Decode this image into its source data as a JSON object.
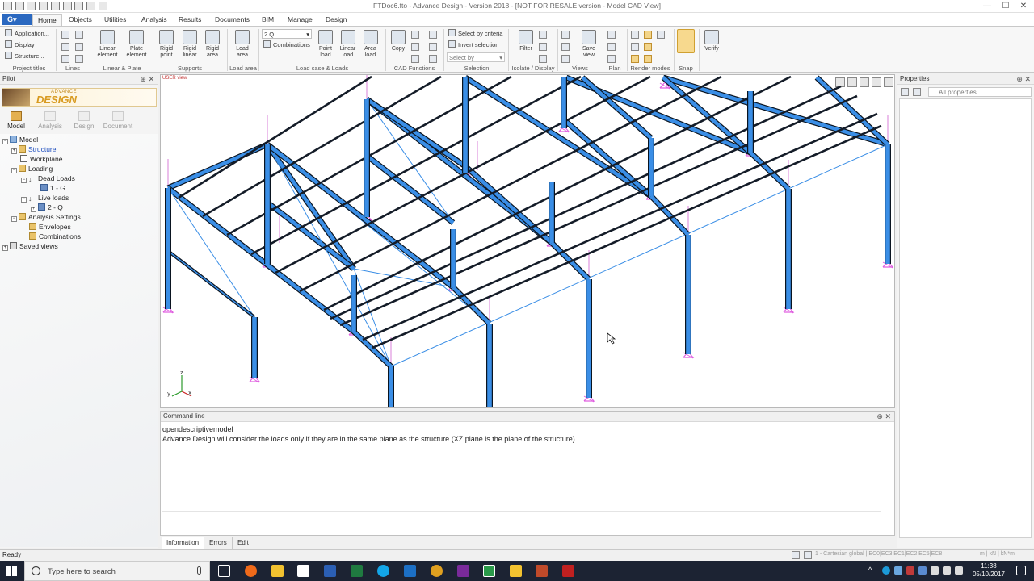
{
  "window": {
    "title": "FTDoc6.fto - Advance Design - Version 2018 - [NOT FOR RESALE version - Model CAD View]",
    "minimize": "—",
    "maximize": "☐",
    "close": "✕"
  },
  "ribbon": {
    "app_button": "G▾",
    "tabs": [
      "Home",
      "Objects",
      "Utilities",
      "Analysis",
      "Results",
      "Documents",
      "BIM",
      "Manage",
      "Design"
    ],
    "project_titles": {
      "application": "Application...",
      "display": "Display",
      "structure": "Structure...",
      "group_label": "Project titles"
    },
    "lines_group": "Lines",
    "linear_plate": {
      "linear_element": "Linear element",
      "plate_element": "Plate element",
      "group_label": "Linear & Plate"
    },
    "supports": {
      "rigid_point": "Rigid point",
      "rigid_linear": "Rigid linear",
      "rigid_area": "Rigid area",
      "group_label": "Supports"
    },
    "load_area": {
      "button": "Load area",
      "group_label": "Load area"
    },
    "load_case": {
      "combo_value": "2 Q",
      "combinations": "Combinations",
      "point_load": "Point load",
      "linear_load": "Linear load",
      "area_load": "Area load",
      "group_label": "Load case & Loads"
    },
    "cad_functions": {
      "copy": "Copy",
      "group_label": "CAD Functions"
    },
    "selection": {
      "select_by_criteria": "Select by criteria",
      "invert_selection": "Invert selection",
      "select_by": "Select by",
      "group_label": "Selection"
    },
    "isolate": {
      "filter": "Filter",
      "group_label": "Isolate / Display"
    },
    "views": {
      "save_view": "Save view",
      "group_label": "Views"
    },
    "plan_group": "Plan",
    "render_modes_group": "Render modes",
    "snap_group": "Snap",
    "verify": "Verify"
  },
  "pilot": {
    "title": "Pilot",
    "logo_line1": "ADVANCE",
    "logo_line2": "DESIGN",
    "tabs": [
      "Model",
      "Analysis",
      "Design",
      "Document"
    ],
    "tree": {
      "model": "Model",
      "structure": "Structure",
      "workplane": "Workplane",
      "loading": "Loading",
      "dead_loads": "Dead Loads",
      "dead_case": "1 - G",
      "live_loads": "Live loads",
      "live_case": "2 - Q",
      "analysis_settings": "Analysis Settings",
      "envelopes": "Envelopes",
      "combinations": "Combinations",
      "saved_views": "Saved views"
    }
  },
  "viewport": {
    "view_label": "USER view",
    "axes": {
      "x": "x",
      "y": "y",
      "z": "z"
    }
  },
  "command_line": {
    "title": "Command line",
    "line1": "opendescriptivemodel",
    "line2": "Advance Design will consider the loads only if they are in the same plane as the structure (XZ plane is the plane of the structure).",
    "tabs": [
      "Information",
      "Errors",
      "Edit"
    ]
  },
  "properties": {
    "title": "Properties",
    "filter": "All properties"
  },
  "status": {
    "ready": "Ready",
    "coordinate_system": "1 - Cartesian global",
    "codes": "EC0|EC3|EC1|EC2|EC5|EC8",
    "units": "m | kN | kN*m"
  },
  "taskbar": {
    "search_placeholder": "Type here to search",
    "time": "11:38",
    "date": "05/10/2017"
  },
  "colors": {
    "member_fill": "#3a8ee6",
    "member_edge": "#0a1420",
    "support": "#e060e0",
    "accent": "#2a68c0"
  }
}
